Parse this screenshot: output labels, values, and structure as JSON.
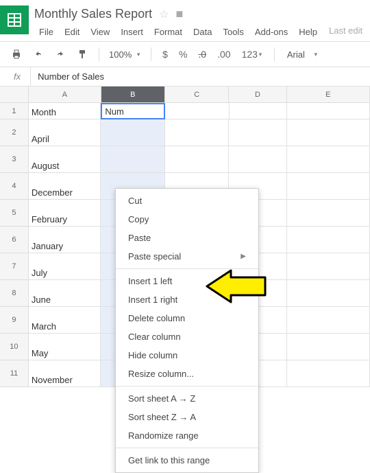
{
  "doc": {
    "title": "Monthly Sales Report"
  },
  "menu": {
    "file": "File",
    "edit": "Edit",
    "view": "View",
    "insert": "Insert",
    "format": "Format",
    "data": "Data",
    "tools": "Tools",
    "addons": "Add-ons",
    "help": "Help",
    "last_edit": "Last edit"
  },
  "toolbar": {
    "zoom": "100%",
    "dollar": "$",
    "percent": "%",
    "dec_dec": ".0",
    "inc_dec": ".00",
    "numfmt": "123",
    "font": "Arial"
  },
  "formula": {
    "fx": "fx",
    "value": "Number of Sales"
  },
  "cols": {
    "a": "A",
    "b": "B",
    "c": "C",
    "d": "D",
    "e": "E"
  },
  "rows": {
    "r1": {
      "n": "1",
      "a": "Month",
      "b": "Num"
    },
    "r2": {
      "n": "2",
      "a": "April"
    },
    "r3": {
      "n": "3",
      "a": "August"
    },
    "r4": {
      "n": "4",
      "a": "December"
    },
    "r5": {
      "n": "5",
      "a": "February"
    },
    "r6": {
      "n": "6",
      "a": "January"
    },
    "r7": {
      "n": "7",
      "a": "July"
    },
    "r8": {
      "n": "8",
      "a": "June"
    },
    "r9": {
      "n": "9",
      "a": "March"
    },
    "r10": {
      "n": "10",
      "a": "May"
    },
    "r11": {
      "n": "11",
      "a": "November"
    }
  },
  "ctx": {
    "cut": "Cut",
    "copy": "Copy",
    "paste": "Paste",
    "paste_special": "Paste special",
    "insert_left": "Insert 1 left",
    "insert_right": "Insert 1 right",
    "delete_col": "Delete column",
    "clear_col": "Clear column",
    "hide_col": "Hide column",
    "resize_col": "Resize column...",
    "sort_az": "Sort sheet A → Z",
    "sort_za": "Sort sheet Z → A",
    "randomize": "Randomize range",
    "get_link": "Get link to this range"
  }
}
